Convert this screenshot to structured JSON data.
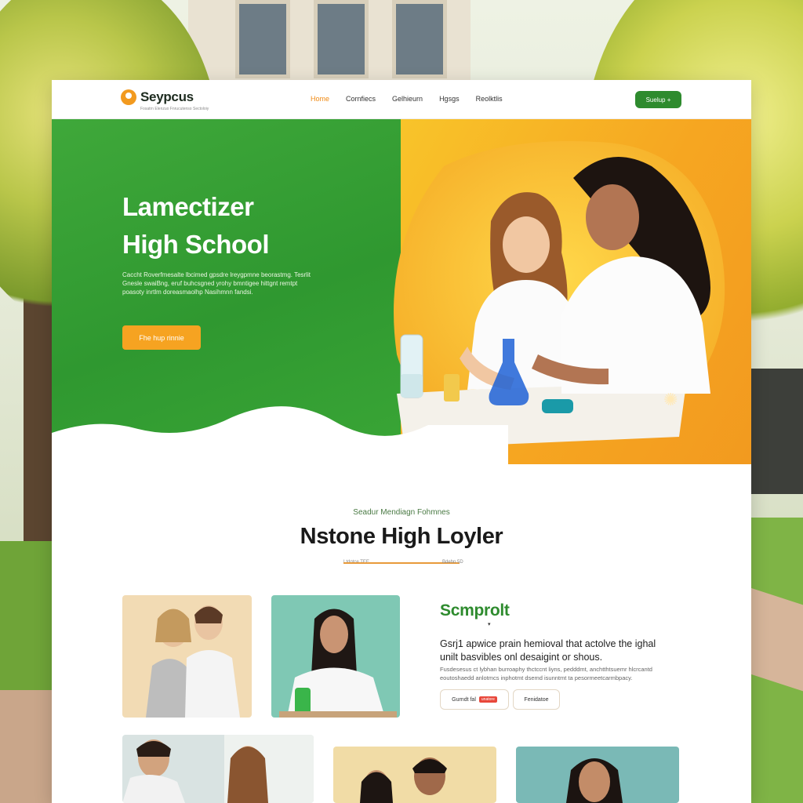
{
  "brand": {
    "name": "Seypcus",
    "tagline": "Fosatrn Elenzuo Fnrucutenso Sectoloiy"
  },
  "nav": {
    "items": [
      {
        "label": "Home",
        "active": true
      },
      {
        "label": "Cornfiecs",
        "active": false
      },
      {
        "label": "Gelhieurn",
        "active": false
      },
      {
        "label": "Hgsgs",
        "active": false
      },
      {
        "label": "Reolktlis",
        "active": false
      }
    ],
    "cta_label": "Suelup +"
  },
  "hero": {
    "title_line1": "Lamectizer",
    "title_line2": "High School",
    "description": "Caccht Roverfmesalte lbcimed gpsdre lreygpmne beorastmg. Tesrlit Gnesle swaiBng, eruf buhcsgned yrohy bmntigee hittgnt remtpt poasoty inrtlm doreasmaolhp Nasihmnn fandsi.",
    "button_label": "Fhe hup rinnie",
    "colors": {
      "green": "#2f9830",
      "orange": "#f6a621"
    }
  },
  "section": {
    "eyebrow": "Seadur Mendiagn Fohmnes",
    "title": "Nstone High Loyler",
    "divider_left": "Ltdotce TEE",
    "divider_right": "Bdehn 5D"
  },
  "feature": {
    "title": "Scmprolt",
    "lead": "Gsrj1 apwice prain hemioval that actolve the ighal unilt basvibles onl desaigint or shous.",
    "body": "Fusdesesus ct lybhan burroaphy thctccnt liyns, pedddmt, anchtthtsuemr hlcrcantd eoutoshaedd anlotmcs inphotmt dsemd isunntmt ta pesormeetcarmbpacy.",
    "chip1_label": "Gurndt fal",
    "chip1_badge": "unatore",
    "chip2_label": "Fenidatoe"
  },
  "icons": {
    "logo": "flame-logo-icon",
    "cta_arrow": "plus-icon",
    "caret": "caret-down-icon",
    "sparkle": "sparkle-icon"
  }
}
